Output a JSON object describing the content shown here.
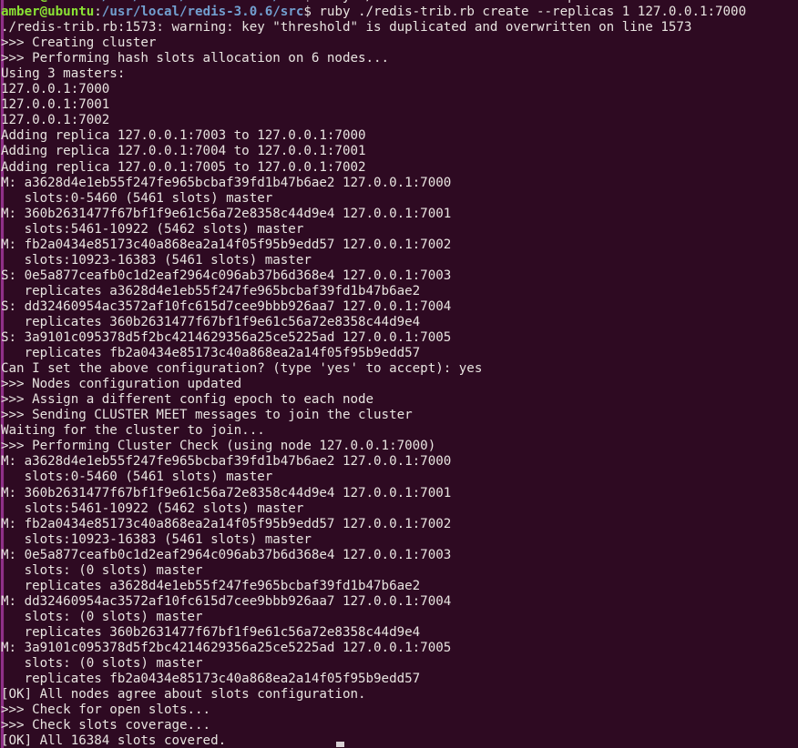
{
  "terminal": {
    "background_color": "#2e0a22",
    "foreground_color": "#e8e4e0",
    "prompt_user_color": "#8ae234",
    "prompt_path_color": "#729fcf",
    "scrollbar_color": "#a0379a",
    "prompt": {
      "user_host": "amber@ubuntu",
      "separator": ":",
      "path": "/usr/local/redis-3.0.6/src",
      "sigil": "$ ",
      "command": "ruby ./redis-trib.rb create --replicas 1 127.0.0.1:7000"
    },
    "lines": [
      {
        "text": "",
        "type": "partial-prompt"
      },
      {
        "text": "",
        "type": "prompt"
      },
      {
        "text": "./redis-trib.rb:1573: warning: key \"threshold\" is duplicated and overwritten on line 1573",
        "type": "plain"
      },
      {
        "text": ">>> Creating cluster",
        "type": "plain"
      },
      {
        "text": ">>> Performing hash slots allocation on 6 nodes...",
        "type": "plain"
      },
      {
        "text": "Using 3 masters:",
        "type": "plain"
      },
      {
        "text": "127.0.0.1:7000",
        "type": "plain"
      },
      {
        "text": "127.0.0.1:7001",
        "type": "plain"
      },
      {
        "text": "127.0.0.1:7002",
        "type": "plain"
      },
      {
        "text": "Adding replica 127.0.0.1:7003 to 127.0.0.1:7000",
        "type": "plain"
      },
      {
        "text": "Adding replica 127.0.0.1:7004 to 127.0.0.1:7001",
        "type": "plain"
      },
      {
        "text": "Adding replica 127.0.0.1:7005 to 127.0.0.1:7002",
        "type": "plain"
      },
      {
        "text": "M: a3628d4e1eb55f247fe965bcbaf39fd1b47b6ae2 127.0.0.1:7000",
        "type": "plain"
      },
      {
        "text": "   slots:0-5460 (5461 slots) master",
        "type": "plain"
      },
      {
        "text": "M: 360b2631477f67bf1f9e61c56a72e8358c44d9e4 127.0.0.1:7001",
        "type": "plain"
      },
      {
        "text": "   slots:5461-10922 (5462 slots) master",
        "type": "plain"
      },
      {
        "text": "M: fb2a0434e85173c40a868ea2a14f05f95b9edd57 127.0.0.1:7002",
        "type": "plain"
      },
      {
        "text": "   slots:10923-16383 (5461 slots) master",
        "type": "plain"
      },
      {
        "text": "S: 0e5a877ceafb0c1d2eaf2964c096ab37b6d368e4 127.0.0.1:7003",
        "type": "plain"
      },
      {
        "text": "   replicates a3628d4e1eb55f247fe965bcbaf39fd1b47b6ae2",
        "type": "plain"
      },
      {
        "text": "S: dd32460954ac3572af10fc615d7cee9bbb926aa7 127.0.0.1:7004",
        "type": "plain"
      },
      {
        "text": "   replicates 360b2631477f67bf1f9e61c56a72e8358c44d9e4",
        "type": "plain"
      },
      {
        "text": "S: 3a9101c095378d5f2bc4214629356a25ce5225ad 127.0.0.1:7005",
        "type": "plain"
      },
      {
        "text": "   replicates fb2a0434e85173c40a868ea2a14f05f95b9edd57",
        "type": "plain"
      },
      {
        "text": "Can I set the above configuration? (type 'yes' to accept): yes",
        "type": "plain"
      },
      {
        "text": ">>> Nodes configuration updated",
        "type": "plain"
      },
      {
        "text": ">>> Assign a different config epoch to each node",
        "type": "plain"
      },
      {
        "text": ">>> Sending CLUSTER MEET messages to join the cluster",
        "type": "plain"
      },
      {
        "text": "Waiting for the cluster to join...",
        "type": "plain"
      },
      {
        "text": ">>> Performing Cluster Check (using node 127.0.0.1:7000)",
        "type": "plain"
      },
      {
        "text": "M: a3628d4e1eb55f247fe965bcbaf39fd1b47b6ae2 127.0.0.1:7000",
        "type": "plain"
      },
      {
        "text": "   slots:0-5460 (5461 slots) master",
        "type": "plain"
      },
      {
        "text": "M: 360b2631477f67bf1f9e61c56a72e8358c44d9e4 127.0.0.1:7001",
        "type": "plain"
      },
      {
        "text": "   slots:5461-10922 (5462 slots) master",
        "type": "plain"
      },
      {
        "text": "M: fb2a0434e85173c40a868ea2a14f05f95b9edd57 127.0.0.1:7002",
        "type": "plain"
      },
      {
        "text": "   slots:10923-16383 (5461 slots) master",
        "type": "plain"
      },
      {
        "text": "M: 0e5a877ceafb0c1d2eaf2964c096ab37b6d368e4 127.0.0.1:7003",
        "type": "plain"
      },
      {
        "text": "   slots: (0 slots) master",
        "type": "plain"
      },
      {
        "text": "   replicates a3628d4e1eb55f247fe965bcbaf39fd1b47b6ae2",
        "type": "plain"
      },
      {
        "text": "M: dd32460954ac3572af10fc615d7cee9bbb926aa7 127.0.0.1:7004",
        "type": "plain"
      },
      {
        "text": "   slots: (0 slots) master",
        "type": "plain"
      },
      {
        "text": "   replicates 360b2631477f67bf1f9e61c56a72e8358c44d9e4",
        "type": "plain"
      },
      {
        "text": "M: 3a9101c095378d5f2bc4214629356a25ce5225ad 127.0.0.1:7005",
        "type": "plain"
      },
      {
        "text": "   slots: (0 slots) master",
        "type": "plain"
      },
      {
        "text": "   replicates fb2a0434e85173c40a868ea2a14f05f95b9edd57",
        "type": "plain"
      },
      {
        "text": "[OK] All nodes agree about slots configuration.",
        "type": "plain"
      },
      {
        "text": ">>> Check for open slots...",
        "type": "plain"
      },
      {
        "text": ">>> Check slots coverage...",
        "type": "plain"
      },
      {
        "text": "[OK] All 16384 slots covered.",
        "type": "plain"
      }
    ]
  }
}
